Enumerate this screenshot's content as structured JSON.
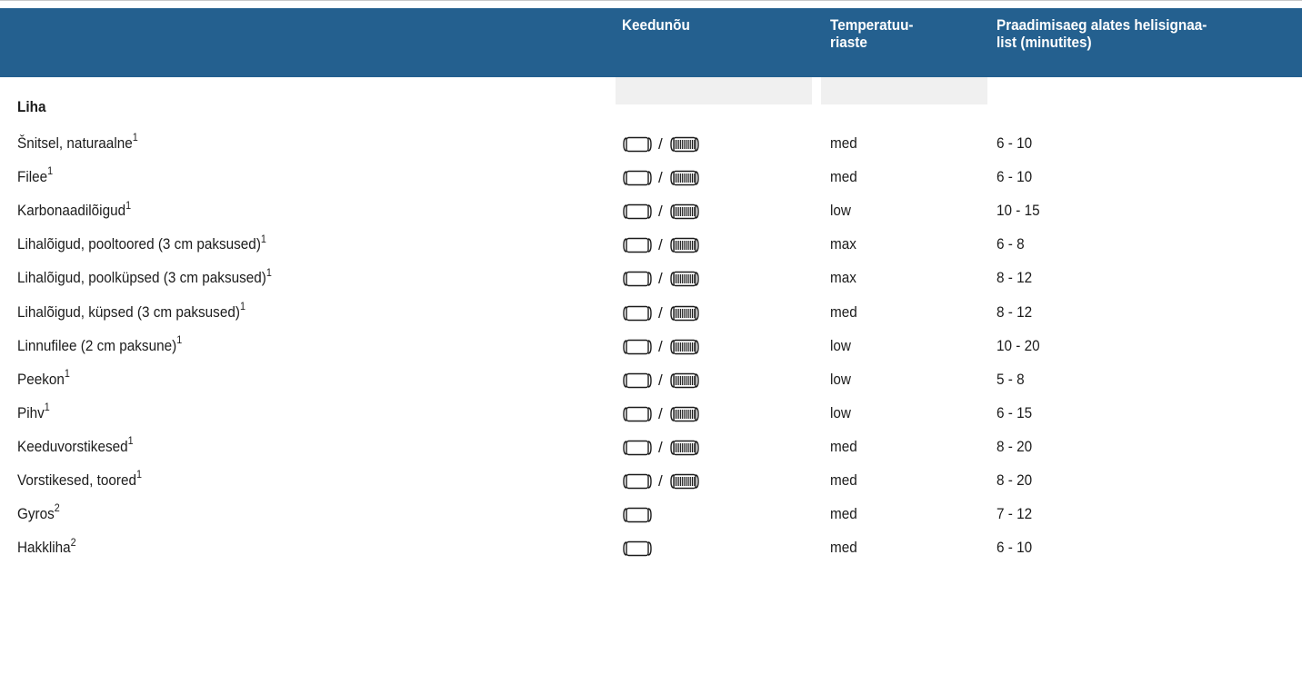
{
  "colors": {
    "header_bg": "#24608f",
    "column_shade": "#f0f0f0",
    "text": "#1c1c1c"
  },
  "header": {
    "cookware": "Keedunõu",
    "temperature_line1": "Temperatuu-",
    "temperature_line2": "riaste",
    "time_line1": "Praadimisaeg alates helisignaa-",
    "time_line2": "list (minutites)"
  },
  "section": {
    "title": "Liha"
  },
  "icons": {
    "pan": "frying-pan-icon",
    "grill": "grill-plate-icon",
    "separator": "/"
  },
  "rows": [
    {
      "name": "Šnitsel, naturaalne",
      "note": "1",
      "grill": true,
      "temp": "med",
      "time": "6 - 10"
    },
    {
      "name": "Filee",
      "note": "1",
      "grill": true,
      "temp": "med",
      "time": "6 - 10"
    },
    {
      "name": "Karbonaadilõigud",
      "note": "1",
      "grill": true,
      "temp": "low",
      "time": "10 - 15"
    },
    {
      "name": "Lihalõigud, pooltoored (3 cm paksused)",
      "note": "1",
      "grill": true,
      "temp": "max",
      "time": "6 - 8"
    },
    {
      "name": "Lihalõigud, poolküpsed (3 cm paksused)",
      "note": "1",
      "grill": true,
      "temp": "max",
      "time": "8 - 12"
    },
    {
      "name": "Lihalõigud, küpsed (3 cm paksused)",
      "note": "1",
      "grill": true,
      "temp": "med",
      "time": "8 - 12"
    },
    {
      "name": "Linnufilee (2 cm paksune)",
      "note": "1",
      "grill": true,
      "temp": "low",
      "time": "10 - 20"
    },
    {
      "name": "Peekon",
      "note": "1",
      "grill": true,
      "temp": "low",
      "time": "5 - 8"
    },
    {
      "name": "Pihv",
      "note": "1",
      "grill": true,
      "temp": "low",
      "time": "6 - 15"
    },
    {
      "name": "Keeduvorstikesed",
      "note": "1",
      "grill": true,
      "temp": "med",
      "time": "8 - 20"
    },
    {
      "name": "Vorstikesed, toored",
      "note": "1",
      "grill": true,
      "temp": "med",
      "time": "8 - 20"
    },
    {
      "name": "Gyros",
      "note": "2",
      "grill": false,
      "temp": "med",
      "time": "7 - 12"
    },
    {
      "name": "Hakkliha",
      "note": "2",
      "grill": false,
      "temp": "med",
      "time": "6 - 10"
    }
  ]
}
